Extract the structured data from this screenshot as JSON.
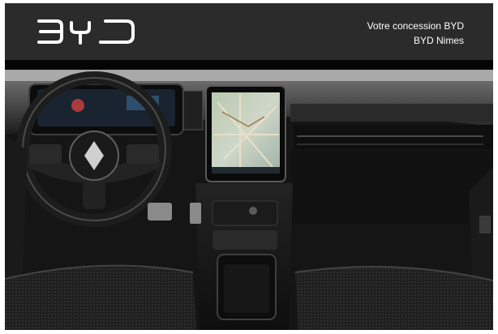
{
  "header": {
    "brand_logo": "BYD",
    "dealer_line1": "Votre concession BYD",
    "dealer_line2": "BYD Nimes"
  },
  "photo": {
    "subject": "car-interior-dashboard"
  }
}
